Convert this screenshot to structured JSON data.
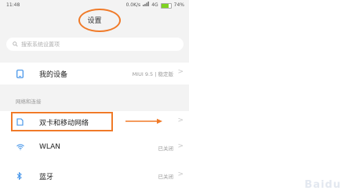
{
  "status_bar": {
    "time": "11:48",
    "network_speed": "0.0K/s",
    "network_type": "4G",
    "battery": "74%",
    "battery_level": 0.74
  },
  "header": {
    "title": "设置"
  },
  "search": {
    "placeholder": "搜索系统设置项"
  },
  "device": {
    "label": "我的设备",
    "value": "MIUI 9.5 | 稳定版"
  },
  "network_section": {
    "header": "网络和连接",
    "items": [
      {
        "label": "双卡和移动网络",
        "value": "",
        "icon": "sim-card-icon"
      },
      {
        "label": "WLAN",
        "value": "已关闭",
        "icon": "wifi-icon"
      },
      {
        "label": "蓝牙",
        "value": "已关闭",
        "icon": "bluetooth-icon"
      }
    ]
  },
  "chevron": ">",
  "watermark": "Baidu",
  "colors": {
    "highlight": "#f07a28",
    "accent_blue": "#3b8fe8",
    "background": "#f3f3f3"
  }
}
